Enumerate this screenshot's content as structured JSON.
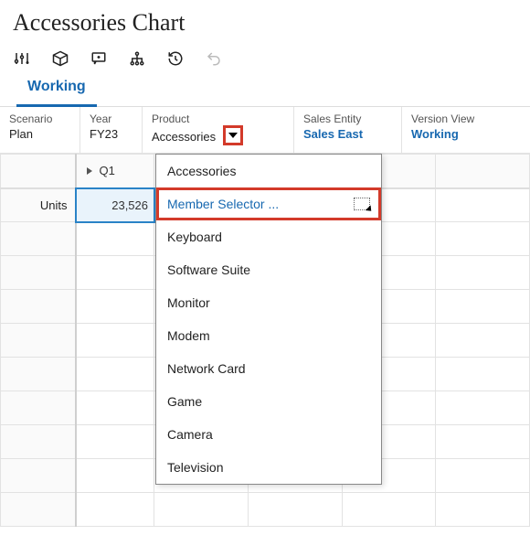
{
  "title": "Accessories Chart",
  "tabs": {
    "working": "Working"
  },
  "pov": {
    "scenario": {
      "label": "Scenario",
      "value": "Plan"
    },
    "year": {
      "label": "Year",
      "value": "FY23"
    },
    "product": {
      "label": "Product",
      "value": "Accessories"
    },
    "entity": {
      "label": "Sales Entity",
      "value": "Sales East"
    },
    "version": {
      "label": "Version View",
      "value": "Working"
    }
  },
  "grid": {
    "col_header": "Q1",
    "row_header": "Units",
    "value": "23,526"
  },
  "menu": {
    "items": [
      "Accessories",
      "Member Selector ...",
      "Keyboard",
      "Software Suite",
      "Monitor",
      "Modem",
      "Network Card",
      "Game",
      "Camera",
      "Television"
    ]
  }
}
